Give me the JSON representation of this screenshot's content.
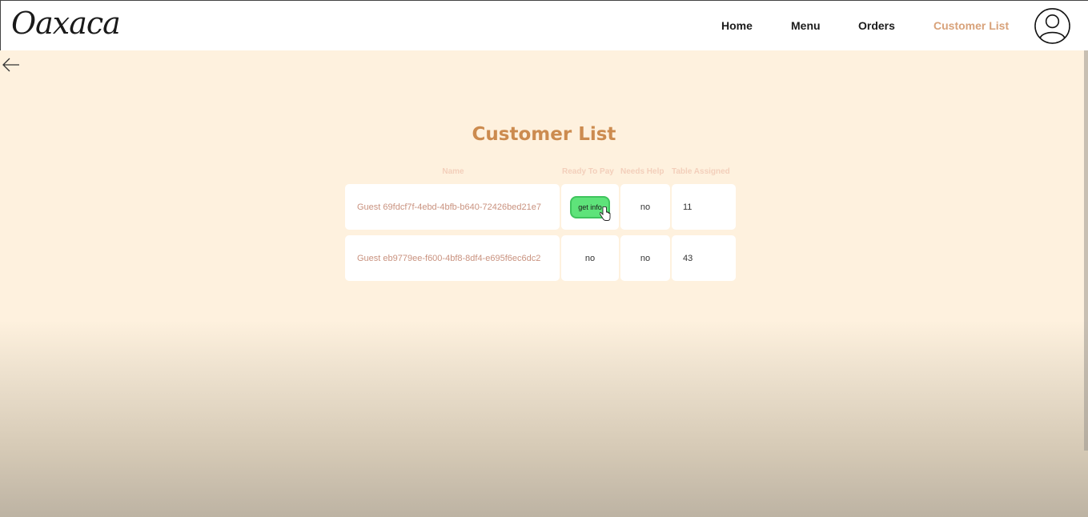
{
  "brand": {
    "logo_text": "Oaxaca"
  },
  "nav": {
    "items": [
      "Home",
      "Menu",
      "Orders",
      "Customer List"
    ],
    "active": "Customer List",
    "active_color": "#d8a27a"
  },
  "icons": {
    "back": "arrow-left-icon",
    "avatar": "user-avatar-icon"
  },
  "page": {
    "title": "Customer List",
    "title_color": "#cc8b4f"
  },
  "table": {
    "headers": [
      "Name",
      "Ready To Pay",
      "Needs Help",
      "Table Assigned"
    ],
    "rows": [
      {
        "name": "Guest 69fdcf7f-4ebd-4bfb-b640-72426bed21e7",
        "ready_to_pay": "get info",
        "needs_help": "no",
        "table_assigned": "11"
      },
      {
        "name": "Guest eb9779ee-f600-4bf8-8df4-e695f6ec6dc2",
        "ready_to_pay": "no",
        "needs_help": "no",
        "table_assigned": "43"
      }
    ],
    "button_color": "#5ee37a"
  }
}
